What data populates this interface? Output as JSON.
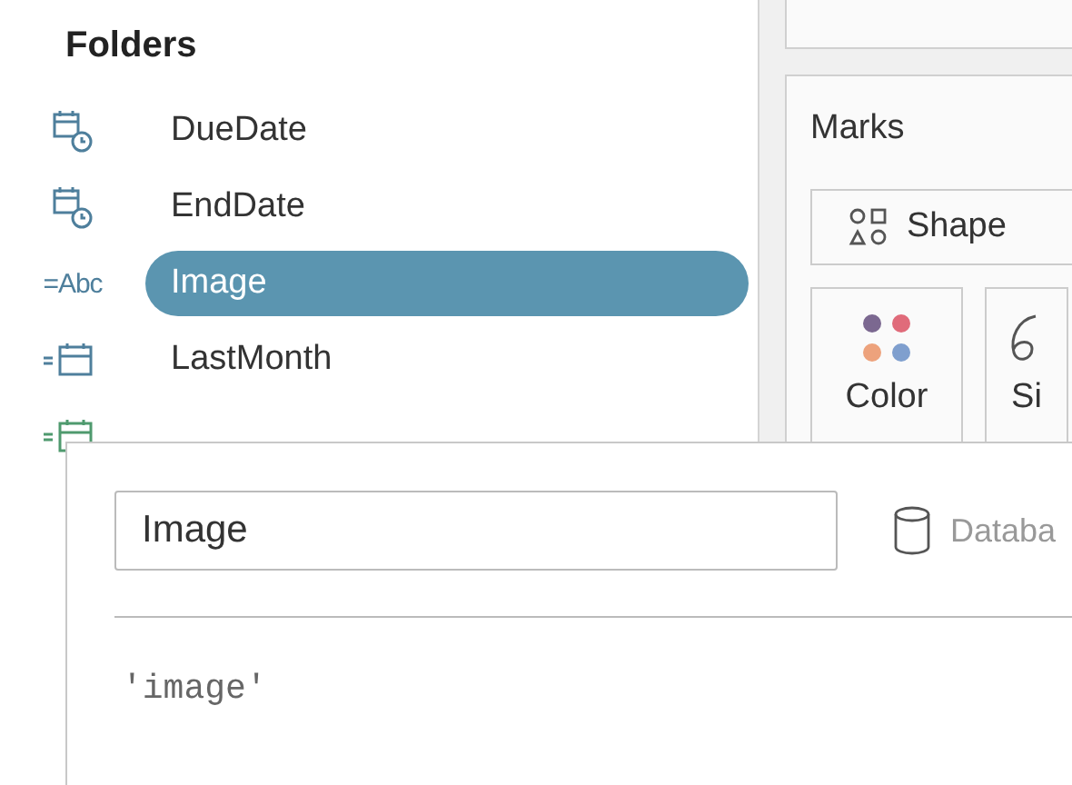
{
  "folders": {
    "title": "Folders",
    "fields": [
      {
        "name": "DueDate",
        "kind": "datetime",
        "selected": false,
        "color": "#4e7f9c"
      },
      {
        "name": "EndDate",
        "kind": "datetime",
        "selected": false,
        "color": "#4e7f9c"
      },
      {
        "name": "Image",
        "kind": "string",
        "type_label": "=Abc",
        "selected": true,
        "color": "#4e7f9c"
      },
      {
        "name": "LastMonth",
        "kind": "date",
        "selected": false,
        "color": "#4e7f9c"
      },
      {
        "kind": "date",
        "color": "#4f9a6e"
      }
    ]
  },
  "marks": {
    "title": "Marks",
    "mark_type": "Shape",
    "cards": [
      {
        "label": "Color",
        "kind": "color"
      },
      {
        "label": "Si",
        "kind": "size"
      }
    ]
  },
  "dialog": {
    "name_value": "Image",
    "source_label": "Databa",
    "formula": "'image'"
  }
}
